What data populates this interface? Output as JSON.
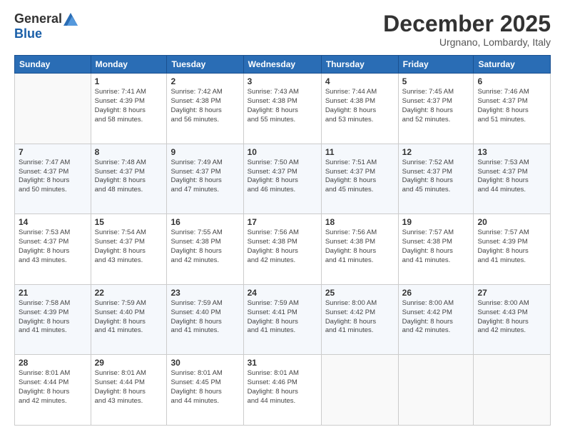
{
  "header": {
    "logo_general": "General",
    "logo_blue": "Blue",
    "month_title": "December 2025",
    "subtitle": "Urgnano, Lombardy, Italy"
  },
  "days_of_week": [
    "Sunday",
    "Monday",
    "Tuesday",
    "Wednesday",
    "Thursday",
    "Friday",
    "Saturday"
  ],
  "weeks": [
    [
      {
        "day": "",
        "info": ""
      },
      {
        "day": "1",
        "info": "Sunrise: 7:41 AM\nSunset: 4:39 PM\nDaylight: 8 hours\nand 58 minutes."
      },
      {
        "day": "2",
        "info": "Sunrise: 7:42 AM\nSunset: 4:38 PM\nDaylight: 8 hours\nand 56 minutes."
      },
      {
        "day": "3",
        "info": "Sunrise: 7:43 AM\nSunset: 4:38 PM\nDaylight: 8 hours\nand 55 minutes."
      },
      {
        "day": "4",
        "info": "Sunrise: 7:44 AM\nSunset: 4:38 PM\nDaylight: 8 hours\nand 53 minutes."
      },
      {
        "day": "5",
        "info": "Sunrise: 7:45 AM\nSunset: 4:37 PM\nDaylight: 8 hours\nand 52 minutes."
      },
      {
        "day": "6",
        "info": "Sunrise: 7:46 AM\nSunset: 4:37 PM\nDaylight: 8 hours\nand 51 minutes."
      }
    ],
    [
      {
        "day": "7",
        "info": "Sunrise: 7:47 AM\nSunset: 4:37 PM\nDaylight: 8 hours\nand 50 minutes."
      },
      {
        "day": "8",
        "info": "Sunrise: 7:48 AM\nSunset: 4:37 PM\nDaylight: 8 hours\nand 48 minutes."
      },
      {
        "day": "9",
        "info": "Sunrise: 7:49 AM\nSunset: 4:37 PM\nDaylight: 8 hours\nand 47 minutes."
      },
      {
        "day": "10",
        "info": "Sunrise: 7:50 AM\nSunset: 4:37 PM\nDaylight: 8 hours\nand 46 minutes."
      },
      {
        "day": "11",
        "info": "Sunrise: 7:51 AM\nSunset: 4:37 PM\nDaylight: 8 hours\nand 45 minutes."
      },
      {
        "day": "12",
        "info": "Sunrise: 7:52 AM\nSunset: 4:37 PM\nDaylight: 8 hours\nand 45 minutes."
      },
      {
        "day": "13",
        "info": "Sunrise: 7:53 AM\nSunset: 4:37 PM\nDaylight: 8 hours\nand 44 minutes."
      }
    ],
    [
      {
        "day": "14",
        "info": "Sunrise: 7:53 AM\nSunset: 4:37 PM\nDaylight: 8 hours\nand 43 minutes."
      },
      {
        "day": "15",
        "info": "Sunrise: 7:54 AM\nSunset: 4:37 PM\nDaylight: 8 hours\nand 43 minutes."
      },
      {
        "day": "16",
        "info": "Sunrise: 7:55 AM\nSunset: 4:38 PM\nDaylight: 8 hours\nand 42 minutes."
      },
      {
        "day": "17",
        "info": "Sunrise: 7:56 AM\nSunset: 4:38 PM\nDaylight: 8 hours\nand 42 minutes."
      },
      {
        "day": "18",
        "info": "Sunrise: 7:56 AM\nSunset: 4:38 PM\nDaylight: 8 hours\nand 41 minutes."
      },
      {
        "day": "19",
        "info": "Sunrise: 7:57 AM\nSunset: 4:38 PM\nDaylight: 8 hours\nand 41 minutes."
      },
      {
        "day": "20",
        "info": "Sunrise: 7:57 AM\nSunset: 4:39 PM\nDaylight: 8 hours\nand 41 minutes."
      }
    ],
    [
      {
        "day": "21",
        "info": "Sunrise: 7:58 AM\nSunset: 4:39 PM\nDaylight: 8 hours\nand 41 minutes."
      },
      {
        "day": "22",
        "info": "Sunrise: 7:59 AM\nSunset: 4:40 PM\nDaylight: 8 hours\nand 41 minutes."
      },
      {
        "day": "23",
        "info": "Sunrise: 7:59 AM\nSunset: 4:40 PM\nDaylight: 8 hours\nand 41 minutes."
      },
      {
        "day": "24",
        "info": "Sunrise: 7:59 AM\nSunset: 4:41 PM\nDaylight: 8 hours\nand 41 minutes."
      },
      {
        "day": "25",
        "info": "Sunrise: 8:00 AM\nSunset: 4:42 PM\nDaylight: 8 hours\nand 41 minutes."
      },
      {
        "day": "26",
        "info": "Sunrise: 8:00 AM\nSunset: 4:42 PM\nDaylight: 8 hours\nand 42 minutes."
      },
      {
        "day": "27",
        "info": "Sunrise: 8:00 AM\nSunset: 4:43 PM\nDaylight: 8 hours\nand 42 minutes."
      }
    ],
    [
      {
        "day": "28",
        "info": "Sunrise: 8:01 AM\nSunset: 4:44 PM\nDaylight: 8 hours\nand 42 minutes."
      },
      {
        "day": "29",
        "info": "Sunrise: 8:01 AM\nSunset: 4:44 PM\nDaylight: 8 hours\nand 43 minutes."
      },
      {
        "day": "30",
        "info": "Sunrise: 8:01 AM\nSunset: 4:45 PM\nDaylight: 8 hours\nand 44 minutes."
      },
      {
        "day": "31",
        "info": "Sunrise: 8:01 AM\nSunset: 4:46 PM\nDaylight: 8 hours\nand 44 minutes."
      },
      {
        "day": "",
        "info": ""
      },
      {
        "day": "",
        "info": ""
      },
      {
        "day": "",
        "info": ""
      }
    ]
  ]
}
